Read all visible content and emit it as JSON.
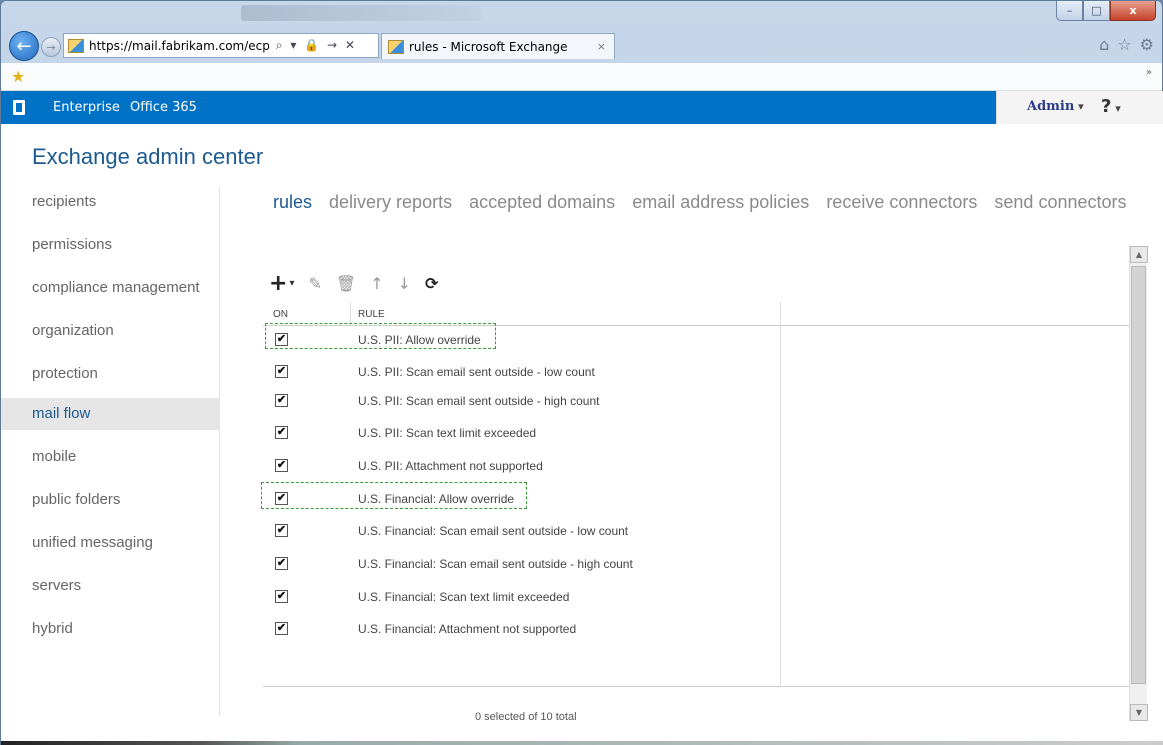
{
  "browser": {
    "address": "https://mail.fabrikam.com/ecp",
    "address_tools": "⌕ ▾ 🔒 → ✕",
    "tab_title": "rules - Microsoft Exchange",
    "tab_close": "×",
    "icons": [
      "home-icon",
      "star-icon",
      "gear-icon"
    ]
  },
  "window": {
    "min": "–",
    "max": "□",
    "close": "x"
  },
  "o365bar": {
    "enterprise": "Enterprise",
    "office365": "Office 365",
    "admin": "Admin",
    "help": "?"
  },
  "app_title": "Exchange admin center",
  "leftnav": {
    "items": [
      {
        "label": "recipients"
      },
      {
        "label": "permissions"
      },
      {
        "label": "compliance management"
      },
      {
        "label": "organization"
      },
      {
        "label": "protection"
      },
      {
        "label": "mail flow"
      },
      {
        "label": "mobile"
      },
      {
        "label": "public folders"
      },
      {
        "label": "unified messaging"
      },
      {
        "label": "servers"
      },
      {
        "label": "hybrid"
      }
    ],
    "active": "mail flow"
  },
  "subtabs": {
    "items": [
      {
        "label": "rules"
      },
      {
        "label": "delivery reports"
      },
      {
        "label": "accepted domains"
      },
      {
        "label": "email address policies"
      },
      {
        "label": "receive connectors"
      },
      {
        "label": "send connectors"
      }
    ],
    "active": "rules"
  },
  "toolbar": {
    "add": "+",
    "add_caret": "▾",
    "edit": "✎",
    "delete": "🗑",
    "up": "↑",
    "down": "↓",
    "refresh": "⟳"
  },
  "grid": {
    "col_on": "ON",
    "col_rule": "RULE",
    "rows": [
      {
        "checked": "✔",
        "rule": "U.S. PII: Allow override"
      },
      {
        "checked": "✔",
        "rule": "U.S. PII: Scan email sent outside - low count"
      },
      {
        "checked": "✔",
        "rule": "U.S. PII: Scan email sent outside - high count"
      },
      {
        "checked": "✔",
        "rule": "U.S. PII: Scan text limit exceeded"
      },
      {
        "checked": "✔",
        "rule": "U.S. PII: Attachment not supported"
      },
      {
        "checked": "✔",
        "rule": "U.S. Financial: Allow override"
      },
      {
        "checked": "✔",
        "rule": "U.S. Financial: Scan email sent outside - low count"
      },
      {
        "checked": "✔",
        "rule": "U.S. Financial: Scan email sent outside - high count"
      },
      {
        "checked": "✔",
        "rule": "U.S. Financial: Scan text limit exceeded"
      },
      {
        "checked": "✔",
        "rule": "U.S. Financial: Attachment not supported"
      }
    ],
    "status": "0 selected of 10 total"
  },
  "scrollbar": {
    "up": "▲",
    "down": "▼"
  },
  "colors": {
    "o365_blue": "#0072c6",
    "title_blue": "#1d5a8f",
    "highlight_green": "#3a9a3a"
  }
}
